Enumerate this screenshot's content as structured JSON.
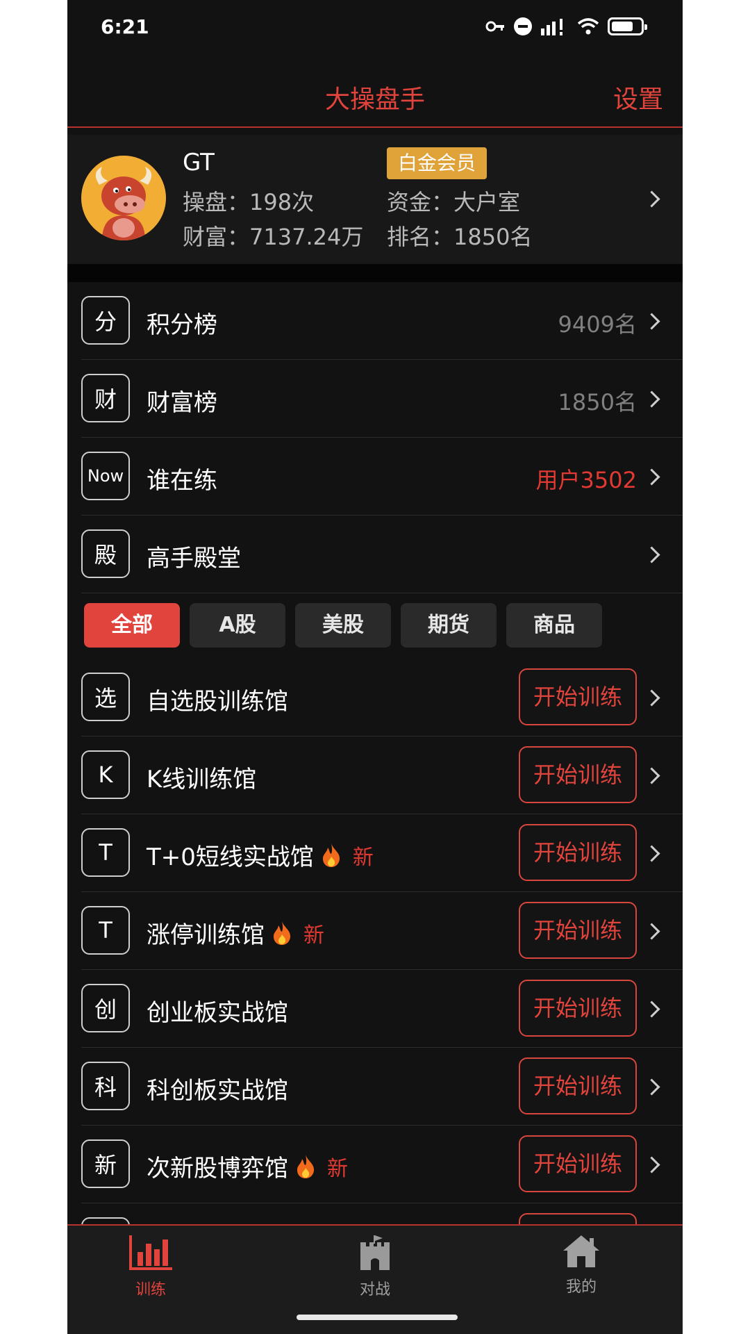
{
  "status_bar": {
    "time": "6:21"
  },
  "header": {
    "title": "大操盘手",
    "settings_label": "设置"
  },
  "profile": {
    "name": "GT",
    "badge": "白金会员",
    "trades": "操盘：198次",
    "funds": "资金：大户室",
    "wealth": "财富：7137.24万",
    "rank": "排名：1850名"
  },
  "menu": [
    {
      "icon": "分",
      "label": "积分榜",
      "value": "9409名"
    },
    {
      "icon": "财",
      "label": "财富榜",
      "value": "1850名"
    },
    {
      "icon": "Now",
      "label": "谁在练",
      "value": "用户3502"
    },
    {
      "icon": "殿",
      "label": "高手殿堂",
      "value": ""
    }
  ],
  "tabs": [
    "全部",
    "A股",
    "美股",
    "期货",
    "商品"
  ],
  "training": {
    "button_label": "开始训练",
    "new_label": "新",
    "items": [
      {
        "icon": "选",
        "label": "自选股训练馆"
      },
      {
        "icon": "K",
        "label": "K线训练馆"
      },
      {
        "icon": "T",
        "label": "T+0短线实战馆"
      },
      {
        "icon": "T",
        "label": "涨停训练馆"
      },
      {
        "icon": "创",
        "label": "创业板实战馆"
      },
      {
        "icon": "科",
        "label": "科创板实战馆"
      },
      {
        "icon": "新",
        "label": "次新股博弈馆"
      }
    ]
  },
  "bottom_nav": [
    {
      "label": "训练",
      "icon": "bar-chart-icon"
    },
    {
      "label": "对战",
      "icon": "castle-icon"
    },
    {
      "label": "我的",
      "icon": "home-icon"
    }
  ],
  "colors": {
    "accent": "#e0443c",
    "badge": "#e0a33a",
    "background": "#121212"
  }
}
